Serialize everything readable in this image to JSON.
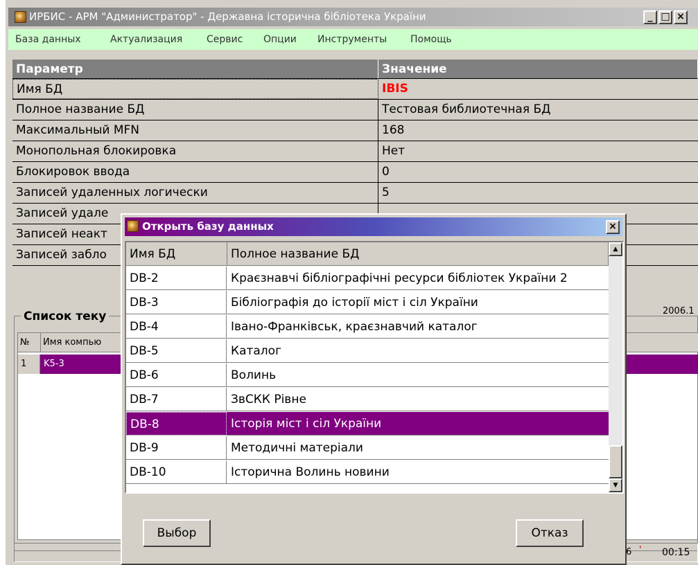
{
  "window": {
    "title": "ИРБИС - АРМ \"Администратор\" - Державна історична бібліотека України",
    "min_glyph": "_",
    "max_glyph": "□",
    "close_glyph": "×"
  },
  "menu": [
    "База данных",
    "Актуализация",
    "Сервис",
    "Опции",
    "Инструменты",
    "Помощь"
  ],
  "grid": {
    "header_param": "Параметр",
    "header_value": "Значение",
    "rows": [
      {
        "param": "Имя БД",
        "value": "IBIS"
      },
      {
        "param": "Полное название БД",
        "value": "Тестовая библиотечная БД"
      },
      {
        "param": "Максимальный MFN",
        "value": "168"
      },
      {
        "param": "Монопольная блокировка",
        "value": "Нет"
      },
      {
        "param": "Блокировок ввода",
        "value": "0"
      },
      {
        "param": "Записей удаленных логически",
        "value": "5"
      },
      {
        "param": "Записей удале",
        "value": ""
      },
      {
        "param": "Записей неакт",
        "value": ""
      },
      {
        "param": "Записей забло",
        "value": ""
      }
    ]
  },
  "panel": {
    "caption": "Список теку",
    "date": "2006.1",
    "list_header_num": "№",
    "list_header_name": "Имя компью",
    "row_num": "1",
    "row_name": "K5-3"
  },
  "status": {
    "fragment": "6",
    "mark": "'",
    "time": "00:15"
  },
  "dialog": {
    "title": "Открыть базу данных",
    "close_glyph": "×",
    "header_name": "Имя БД",
    "header_full": "Полное название БД",
    "rows": [
      {
        "name": "DB-2",
        "full": "Краєзнавчі бібліографічні ресурси бібліотек України 2"
      },
      {
        "name": "DB-3",
        "full": "Бібліографія до історії міст і сіл України"
      },
      {
        "name": "DB-4",
        "full": "Івано-Франківськ, краєзнавчий каталог"
      },
      {
        "name": "DB-5",
        "full": "Каталог"
      },
      {
        "name": "DB-6",
        "full": "Волинь"
      },
      {
        "name": "DB-7",
        "full": "ЗвСКК Рівне"
      },
      {
        "name": "DB-8",
        "full": "Історія міст і сіл України"
      },
      {
        "name": "DB-9",
        "full": "Методичні матеріали"
      },
      {
        "name": "DB-10",
        "full": "Історична Волинь новини"
      }
    ],
    "selected_row": "DB-8",
    "scroll_up_glyph": "▲",
    "scroll_down_glyph": "▼",
    "select_label": "Выбор",
    "cancel_label": "Отказ"
  }
}
